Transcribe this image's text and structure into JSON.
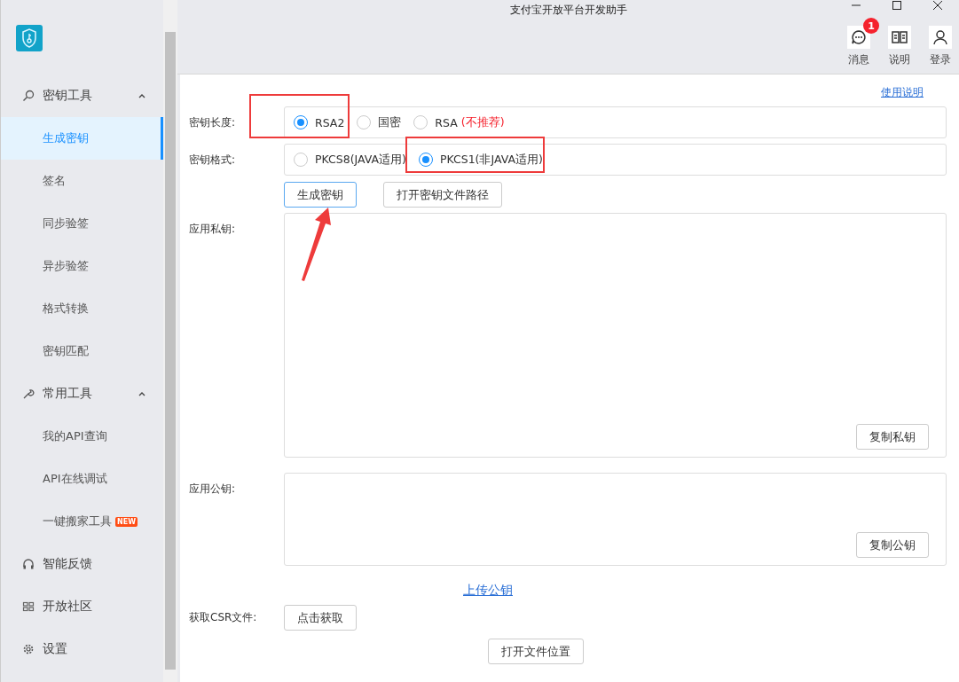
{
  "window": {
    "title": "支付宝开放平台开发助手"
  },
  "toolbar": [
    {
      "label": "消息",
      "badge": "1"
    },
    {
      "label": "说明"
    },
    {
      "label": "登录"
    }
  ],
  "sidebar": {
    "items": [
      {
        "kind": "group",
        "label": "密钥工具",
        "expanded": true,
        "children": [
          {
            "label": "生成密钥",
            "selected": true
          },
          {
            "label": "签名",
            "selected": false
          },
          {
            "label": "同步验签",
            "selected": false
          },
          {
            "label": "异步验签",
            "selected": false
          },
          {
            "label": "格式转换",
            "selected": false
          },
          {
            "label": "密钥匹配",
            "selected": false
          }
        ]
      },
      {
        "kind": "group",
        "label": "常用工具",
        "expanded": true,
        "children": [
          {
            "label": "我的API查询",
            "selected": false
          },
          {
            "label": "API在线调试",
            "selected": false
          },
          {
            "label": "一键搬家工具",
            "selected": false,
            "badge": "NEW"
          }
        ]
      },
      {
        "kind": "link",
        "label": "智能反馈"
      },
      {
        "kind": "link",
        "label": "开放社区"
      },
      {
        "kind": "link",
        "label": "设置"
      }
    ]
  },
  "help_link": "使用说明",
  "key_length": {
    "label": "密钥长度:",
    "options": [
      {
        "label": "RSA2",
        "selected": true
      },
      {
        "label": "国密",
        "selected": false
      },
      {
        "label": "RSA",
        "selected": false,
        "note": "(不推荐)"
      }
    ]
  },
  "key_format": {
    "label": "密钥格式:",
    "options": [
      {
        "label": "PKCS8(JAVA适用)",
        "selected": false
      },
      {
        "label": "PKCS1(非JAVA适用)",
        "selected": true
      }
    ]
  },
  "actions": [
    {
      "label": "生成密钥",
      "primary": true
    },
    {
      "label": "打开密钥文件路径",
      "primary": false
    }
  ],
  "private_key": {
    "label": "应用私钥:",
    "copy_button": "复制私钥"
  },
  "public_key": {
    "label": "应用公钥:",
    "copy_button": "复制公钥"
  },
  "upload_link": "上传公钥",
  "csr": {
    "label": "获取CSR文件:",
    "button": "点击获取"
  },
  "open_location_button": "打开文件位置"
}
